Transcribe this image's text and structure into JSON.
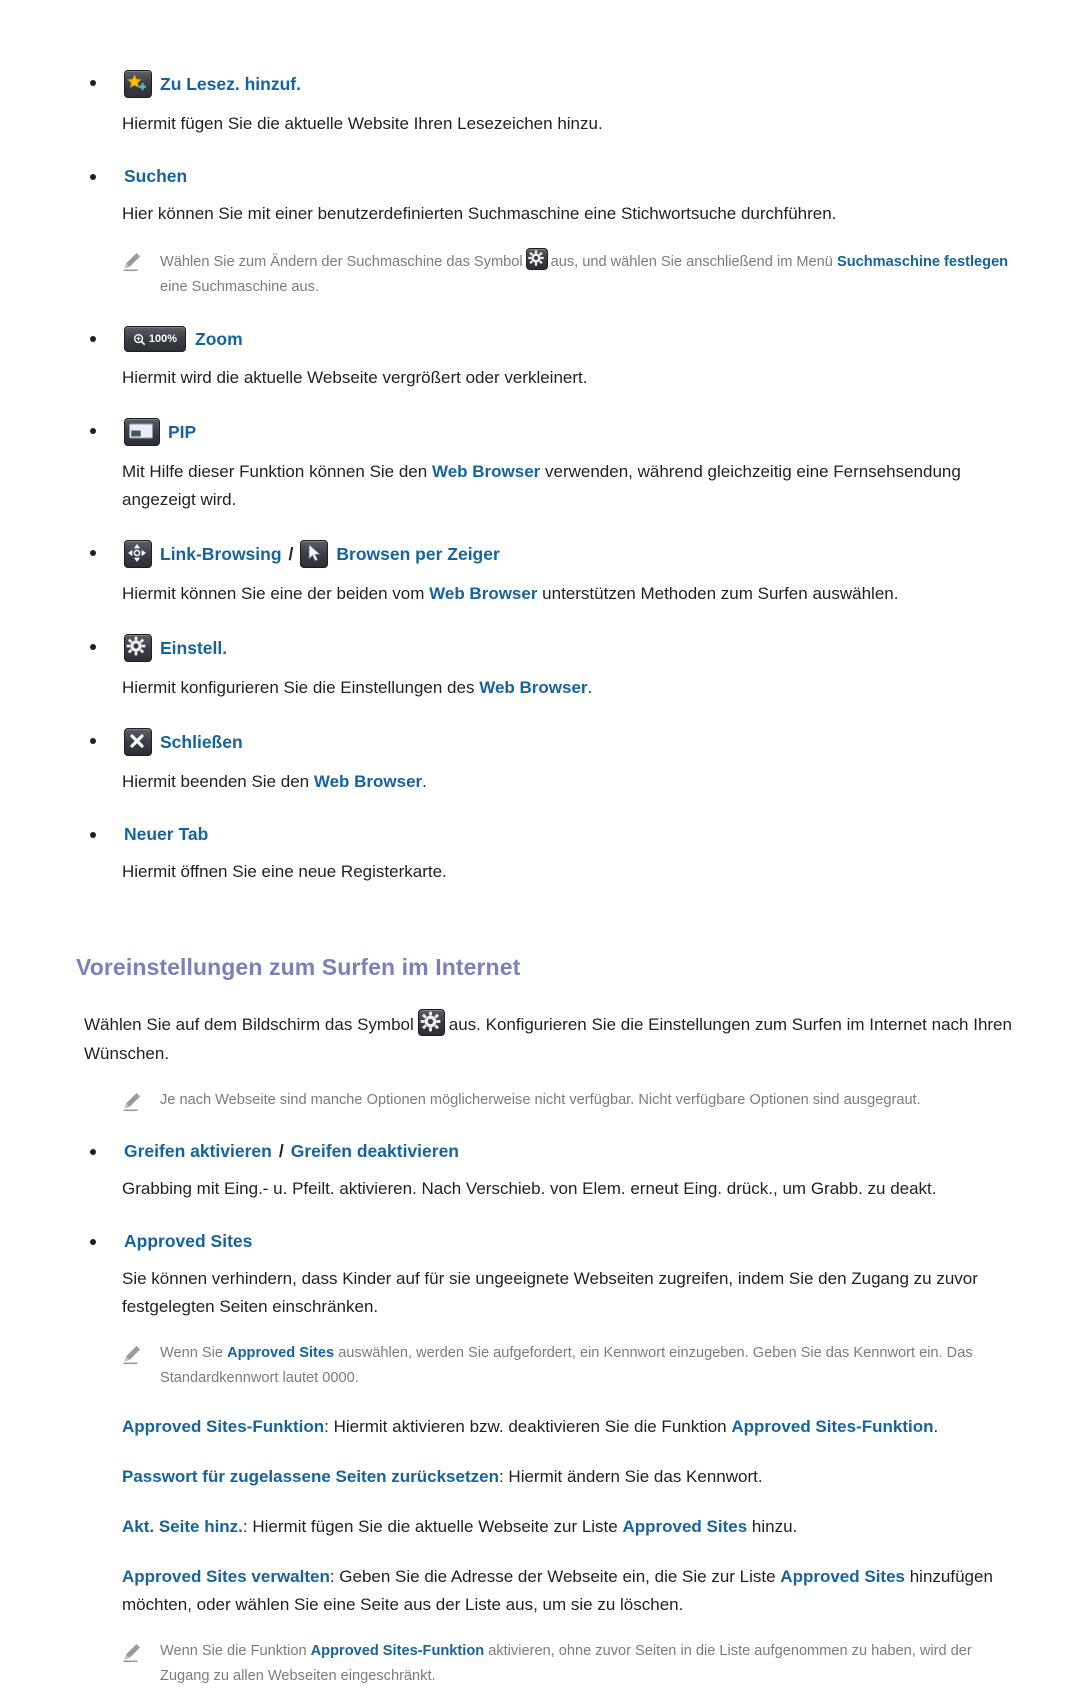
{
  "page": {
    "items": [
      {
        "id": "add-bookmark",
        "icon": "bookmark-star-icon",
        "title": "Zu Lesez. hinzuf.",
        "body": "Hiermit fügen Sie die aktuelle Website Ihren Lesezeichen hinzu."
      },
      {
        "id": "search",
        "icon": null,
        "title": "Suchen",
        "body": "Hier können Sie mit einer benutzerdefinierten Suchmaschine eine Stichwortsuche durchführen.",
        "note": {
          "before": "Wählen Sie zum Ändern der Suchmaschine das Symbol",
          "icon": "gear-icon",
          "middle": "aus, und wählen Sie anschließend im Menü",
          "bold": "Suchmaschine festlegen",
          "after": "eine Suchmaschine aus."
        }
      },
      {
        "id": "zoom",
        "icon": "zoom-100-icon",
        "icon_label": "100%",
        "title": "Zoom",
        "body": "Hiermit wird die aktuelle Webseite vergrößert oder verkleinert."
      },
      {
        "id": "pip",
        "icon": "pip-icon",
        "title": "PIP",
        "body_parts": [
          {
            "text": "Mit Hilfe dieser Funktion können Sie den ",
            "bold": false
          },
          {
            "text": "Web Browser",
            "bold": true
          },
          {
            "text": " verwenden, während gleichzeitig eine Fernsehsendung angezeigt wird.",
            "bold": false
          }
        ]
      },
      {
        "id": "link-browsing",
        "icon": "dpad-arrows-icon",
        "title": "Link-Browsing",
        "separator": "/",
        "icon2": "pointer-cursor-icon",
        "title2": "Browsen per Zeiger",
        "body_parts": [
          {
            "text": "Hiermit können Sie eine der beiden vom ",
            "bold": false
          },
          {
            "text": "Web Browser",
            "bold": true
          },
          {
            "text": " unterstützen Methoden zum Surfen auswählen.",
            "bold": false
          }
        ]
      },
      {
        "id": "settings",
        "icon": "gear-icon",
        "title": "Einstell.",
        "body_parts": [
          {
            "text": "Hiermit konfigurieren Sie die Einstellungen des ",
            "bold": false
          },
          {
            "text": "Web Browser",
            "bold": true
          },
          {
            "text": ".",
            "bold": false
          }
        ]
      },
      {
        "id": "close",
        "icon": "close-x-icon",
        "title": "Schließen",
        "body_parts": [
          {
            "text": "Hiermit beenden Sie den ",
            "bold": false
          },
          {
            "text": "Web Browser",
            "bold": true
          },
          {
            "text": ".",
            "bold": false
          }
        ]
      },
      {
        "id": "new-tab",
        "icon": null,
        "title": "Neuer Tab",
        "body": "Hiermit öffnen Sie eine neue Registerkarte."
      }
    ],
    "section": {
      "heading": "Voreinstellungen zum Surfen im Internet",
      "lead": {
        "before": "Wählen Sie auf dem Bildschirm das Symbol",
        "icon": "gear-icon",
        "after": "aus. Konfigurieren Sie die Einstellungen zum Surfen im Internet nach Ihren Wünschen."
      },
      "note_top": "Je nach Webseite sind manche Optionen möglicherweise nicht verfügbar. Nicht verfügbare Optionen sind ausgegraut.",
      "items": [
        {
          "id": "grab-toggle",
          "title": "Greifen aktivieren",
          "separator": "/",
          "title2": "Greifen deaktivieren",
          "body": "Grabbing mit Eing.- u. Pfeilt. aktivieren. Nach Verschieb. von Elem. erneut Eing. drück., um Grabb. zu deakt."
        },
        {
          "id": "approved-sites",
          "title": "Approved Sites",
          "body": "Sie können verhindern, dass Kinder auf für sie ungeeignete Webseiten zugreifen, indem Sie den Zugang zu zuvor festgelegten Seiten einschränken.",
          "note": {
            "before": "Wenn Sie",
            "bold": "Approved Sites",
            "after": "auswählen, werden Sie aufgefordert, ein Kennwort einzugeben. Geben Sie das Kennwort ein. Das Standardkennwort lautet 0000."
          },
          "sub_items": [
            {
              "id": "approved-sites-function",
              "parts": [
                {
                  "text": "Approved Sites-Funktion",
                  "bold": true
                },
                {
                  "text": ": Hiermit aktivieren bzw. deaktivieren Sie die Funktion ",
                  "bold": false
                },
                {
                  "text": "Approved Sites-Funktion",
                  "bold": true
                },
                {
                  "text": ".",
                  "bold": false
                }
              ]
            },
            {
              "id": "reset-password",
              "parts": [
                {
                  "text": "Passwort für zugelassene Seiten zurücksetzen",
                  "bold": true
                },
                {
                  "text": ": Hiermit ändern Sie das Kennwort.",
                  "bold": false
                }
              ]
            },
            {
              "id": "add-current-page",
              "parts": [
                {
                  "text": "Akt. Seite hinz.",
                  "bold": true
                },
                {
                  "text": ": Hiermit fügen Sie die aktuelle Webseite zur Liste ",
                  "bold": false
                },
                {
                  "text": "Approved Sites",
                  "bold": true
                },
                {
                  "text": " hinzu.",
                  "bold": false
                }
              ]
            },
            {
              "id": "manage-approved-sites",
              "parts": [
                {
                  "text": "Approved Sites verwalten",
                  "bold": true
                },
                {
                  "text": ": Geben Sie die Adresse der Webseite ein, die Sie zur Liste ",
                  "bold": false
                },
                {
                  "text": "Approved Sites",
                  "bold": true
                },
                {
                  "text": " hinzufügen möchten, oder wählen Sie eine Seite aus der Liste aus, um sie zu löschen.",
                  "bold": false
                }
              ]
            }
          ],
          "note_bottom": {
            "before": "Wenn Sie die Funktion",
            "bold": "Approved Sites-Funktion",
            "after": "aktivieren, ohne zuvor Seiten in die Liste aufgenommen zu haben, wird der Zugang zu allen Webseiten eingeschränkt."
          }
        }
      ]
    },
    "colors": {
      "link_blue": "#15639f",
      "heading_purple": "#7b80bd",
      "body_text": "#231f20",
      "note_gray": "#7c7c7c",
      "star_yellow": "#f2c200",
      "plus_teal": "#3ec6c6"
    }
  }
}
